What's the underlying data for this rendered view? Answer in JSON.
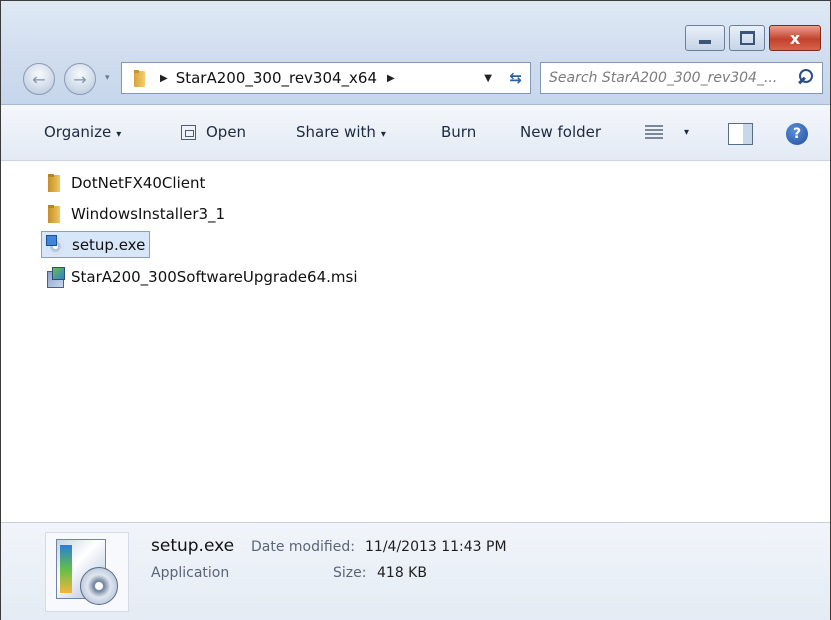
{
  "window": {
    "minimize_icon": "minimize-icon",
    "maximize_icon": "maximize-icon",
    "close_glyph": "x"
  },
  "nav": {
    "back_glyph": "←",
    "forward_glyph": "→",
    "history_glyph": "▾"
  },
  "address": {
    "path": "StarA200_300_rev304_x64",
    "sep_glyph": "▶",
    "dropdown_glyph": "▼",
    "refresh_glyph": "⇆"
  },
  "search": {
    "placeholder": "Search StarA200_300_rev304_..."
  },
  "commands": {
    "organize": "Organize",
    "open": "Open",
    "share_with": "Share with",
    "burn": "Burn",
    "new_folder": "New folder",
    "caret": "▾",
    "help": "?"
  },
  "files": [
    {
      "name": "DotNetFX40Client",
      "type": "folder",
      "icon": "folder-icon"
    },
    {
      "name": "WindowsInstaller3_1",
      "type": "folder",
      "icon": "folder-icon"
    },
    {
      "name": "setup.exe",
      "type": "application",
      "icon": "setup-icon",
      "selected": true
    },
    {
      "name": "StarA200_300SoftwareUpgrade64.msi",
      "type": "installer",
      "icon": "msi-icon"
    }
  ],
  "details": {
    "name": "setup.exe",
    "modified_label": "Date modified:",
    "modified_value": "11/4/2013 11:43 PM",
    "type": "Application",
    "size_label": "Size:",
    "size_value": "418 KB"
  },
  "colors": {
    "chrome": "#cfdcee",
    "selection": "#d7e6f8",
    "close_button": "#c2422c",
    "help_blue": "#1f4f9f"
  }
}
